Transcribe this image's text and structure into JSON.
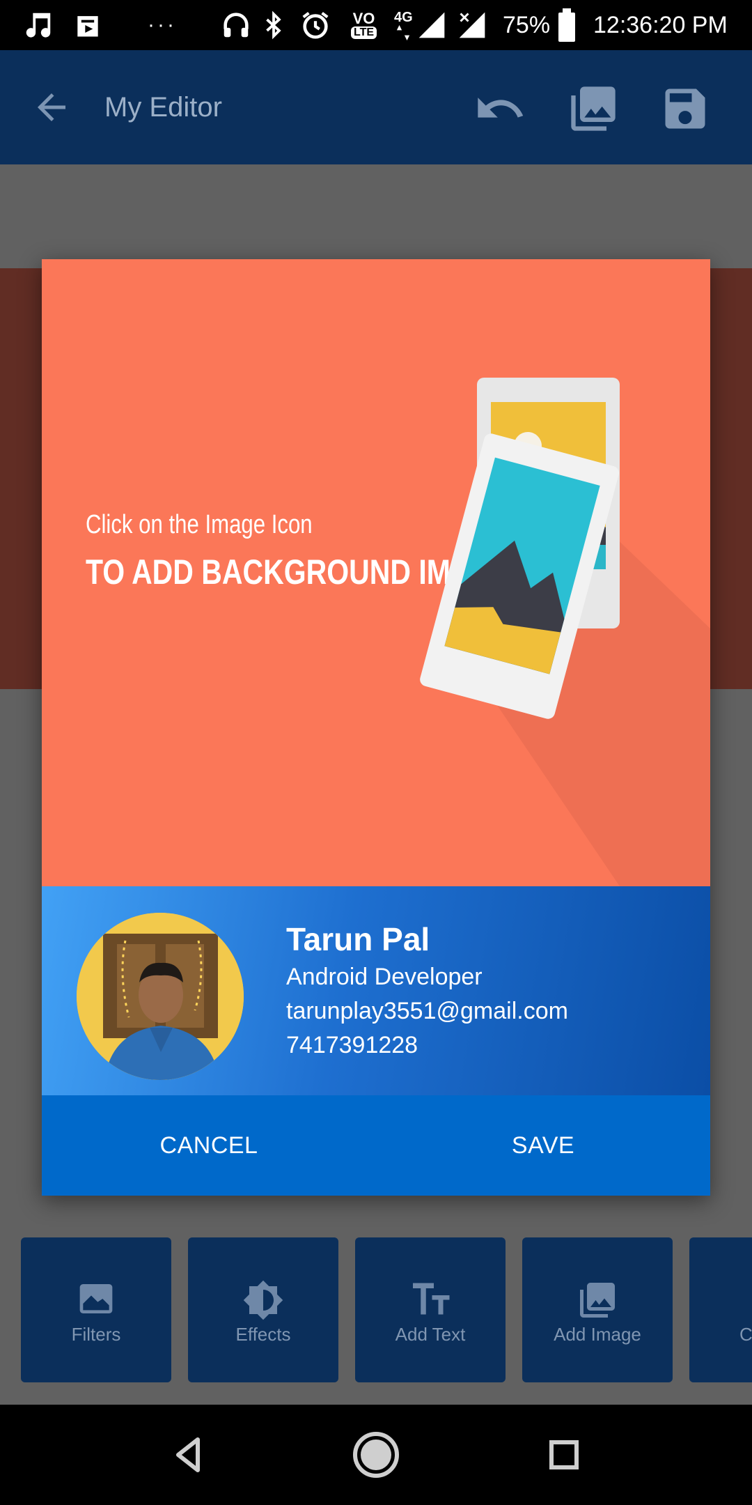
{
  "status_bar": {
    "battery": "75%",
    "time": "12:36:20 PM",
    "more_dots": "···",
    "network_type": "4G",
    "volte": "VO",
    "lte": "LTE",
    "icons": [
      "music-icon",
      "shopping-bag-icon",
      "headphones-icon",
      "bluetooth-icon",
      "alarm-icon",
      "volte-icon",
      "signal-icon",
      "battery-icon"
    ]
  },
  "app_bar": {
    "title": "My Editor",
    "icons": [
      "back-arrow-icon",
      "undo-icon",
      "gallery-icon",
      "save-icon"
    ]
  },
  "dialog": {
    "preview": {
      "line1": "Click on the Image Icon",
      "line2": "TO ADD BACKGROUND IMAGE"
    },
    "profile": {
      "name": "Tarun Pal",
      "role": "Android Developer",
      "email": "tarunplay3551@gmail.com",
      "phone": "7417391228"
    },
    "cancel_label": "CANCEL",
    "save_label": "SAVE"
  },
  "tools": [
    {
      "label": "Filters",
      "icon": "image-icon"
    },
    {
      "label": "Effects",
      "icon": "brightness-icon"
    },
    {
      "label": "Add Text",
      "icon": "text-icon"
    },
    {
      "label": "Add Image",
      "icon": "gallery-icon"
    },
    {
      "label": "C",
      "icon": "plus-icon"
    }
  ],
  "colors": {
    "app_bar": "#0b2f5b",
    "preview_bg": "#fb7758",
    "action_bar": "#0069ca",
    "profile_gradient_start": "#42a1f5",
    "profile_gradient_end": "#0b4ea6"
  }
}
